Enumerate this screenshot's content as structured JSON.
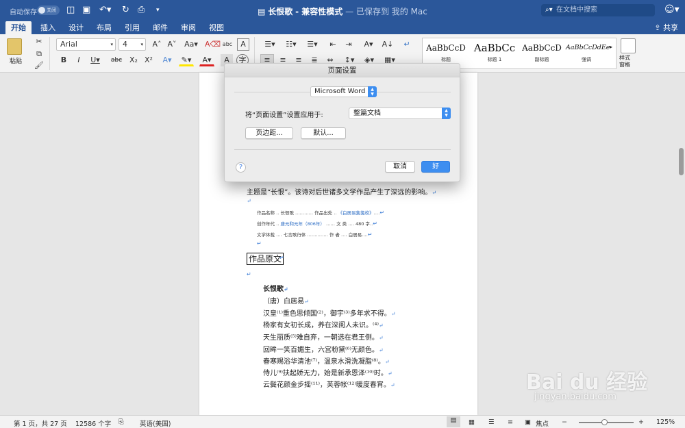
{
  "titlebar": {
    "autosave_label": "自动保存",
    "autosave_toggle": "关闭",
    "doc_name": "长恨歌",
    "compat_mode": "兼容性模式",
    "save_status": "— 已保存到 我的 Mac",
    "search_placeholder": "在文档中搜索"
  },
  "tabs": [
    "开始",
    "插入",
    "设计",
    "布局",
    "引用",
    "邮件",
    "审阅",
    "视图"
  ],
  "share_label": "共享",
  "ribbon": {
    "paste_label": "粘贴",
    "font_name": "Arial",
    "font_size": "4",
    "styles": [
      {
        "preview": "AaBbCcD",
        "name": "标题"
      },
      {
        "preview": "AaBbCc",
        "name": "标题 1"
      },
      {
        "preview": "AaBbCcD",
        "name": "副标题"
      },
      {
        "preview": "AaBbCcDdEe",
        "name": "强调"
      }
    ],
    "styles_pane_label": "样式\n窗格"
  },
  "document": {
    "line1": "主题是“长恨”。该诗对后世诸多文学作品产生了深远的影响。",
    "info": [
      {
        "a": "作品名称",
        "b": "长恨歌",
        "c": "作品出处",
        "d": "《白居易集笺校》"
      },
      {
        "a": "创作年代",
        "b": "唐元和元年（806年）",
        "c": "文  类",
        "d": "480 字"
      },
      {
        "a": "文学体裁",
        "b": "七言歌行体",
        "c": "作  者",
        "d": "白居易"
      }
    ],
    "heading": "作品原文",
    "poem_title": "长恨歌",
    "poem_author": "（唐）白居易",
    "poem_lines": [
      "汉皇⁽¹⁾重色思倾国⁽²⁾，御宇⁽³⁾多年求不得。",
      "杨家有女初长成，养在深闺人未识。⁽⁴⁾",
      "天生丽质⁽⁵⁾难自弃，一朝选在君王侧。",
      "回眸一笑百媚生，六宫粉黛⁽⁶⁾无颜色。",
      "春寒赐浴华清池⁽⁷⁾，温泉水滑洗凝脂⁽⁸⁾。",
      "侍儿⁽⁹⁾扶起娇无力，始是新承恩泽⁽¹⁰⁾时。",
      "云鬓花颜金步摇⁽¹¹⁾，芙蓉帐⁽¹²⁾暖度春宵。"
    ]
  },
  "dialog": {
    "title": "页面设置",
    "app_select": "Microsoft Word",
    "apply_label": "将“页面设置”设置应用于:",
    "apply_value": "整篇文档",
    "margins_button": "页边距...",
    "default_button": "默认...",
    "help": "?",
    "cancel_button": "取消",
    "ok_button": "好"
  },
  "statusbar": {
    "page": "第 1 页，共 27 页",
    "words": "12586 个字",
    "language": "英语(美国)",
    "focus": "焦点",
    "zoom": "125%"
  },
  "watermark": {
    "brand": "Bai du 经验",
    "url": "jingyan.baidu.com"
  }
}
